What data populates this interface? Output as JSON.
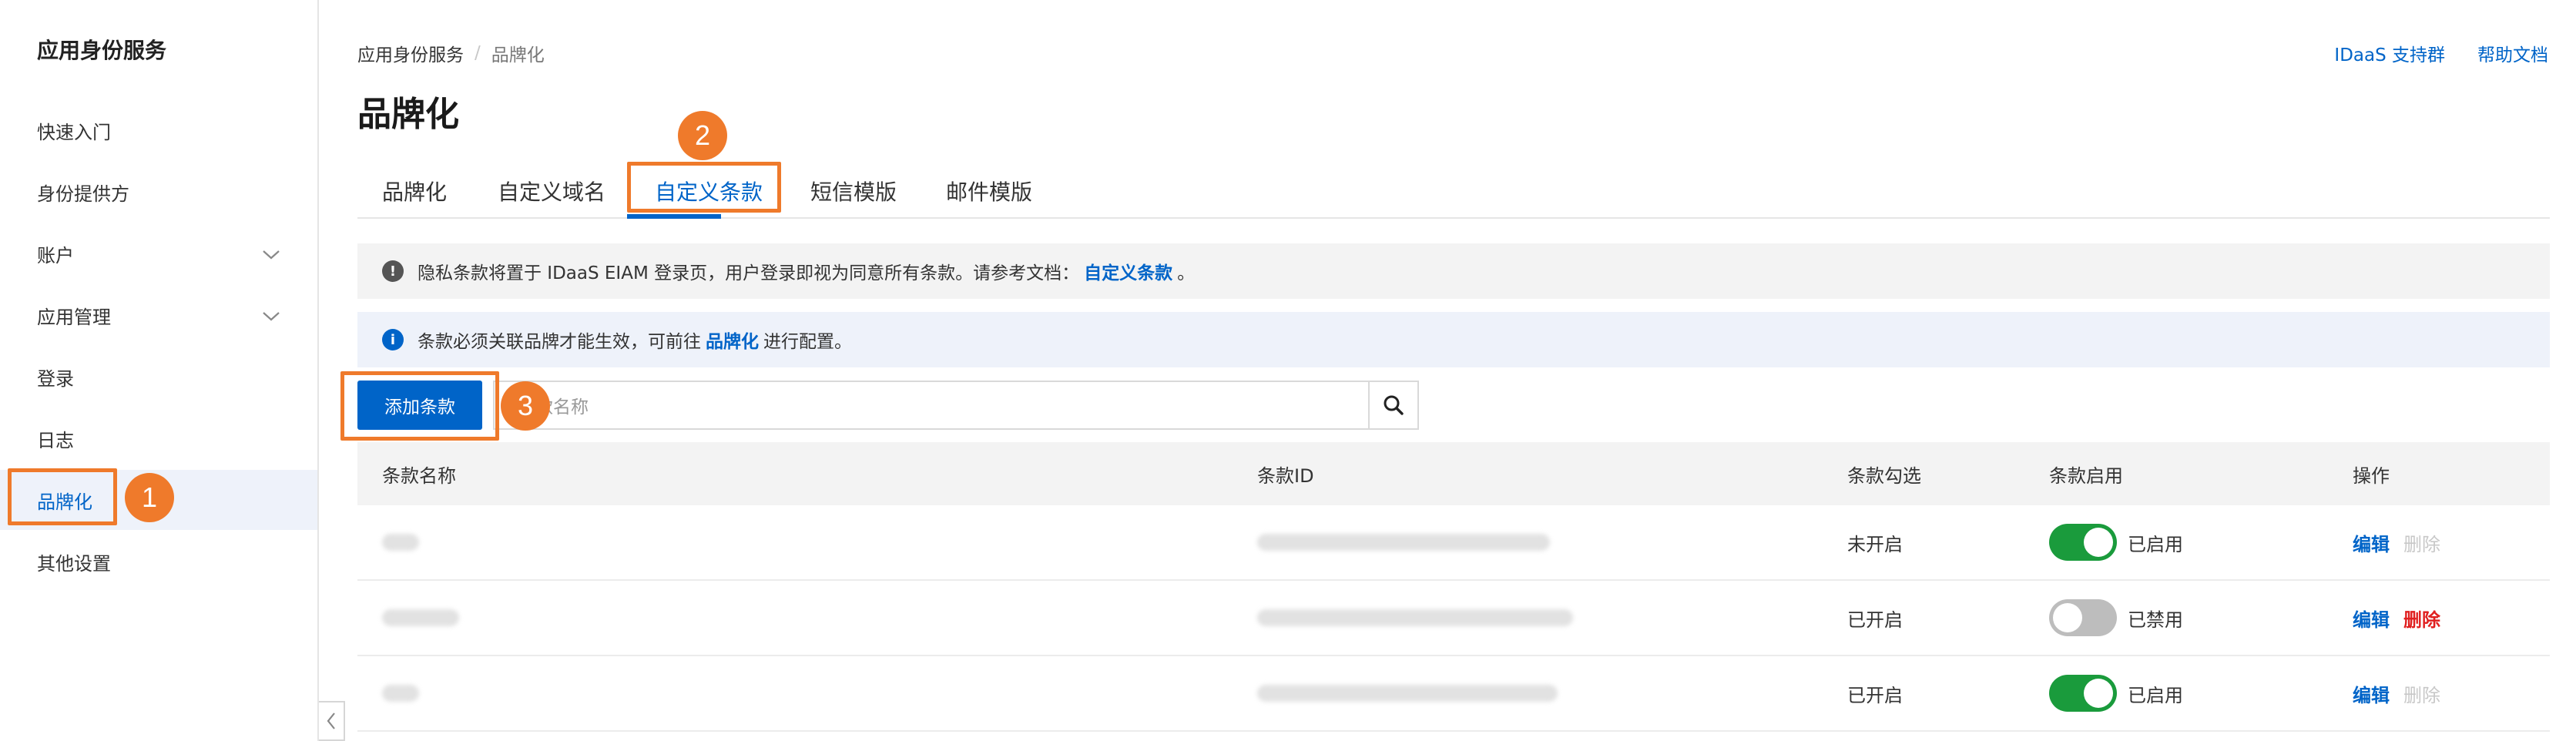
{
  "sidebar": {
    "app_title": "应用身份服务",
    "items": [
      {
        "label": "快速入门",
        "expandable": false,
        "active": false
      },
      {
        "label": "身份提供方",
        "expandable": false,
        "active": false
      },
      {
        "label": "账户",
        "expandable": true,
        "active": false
      },
      {
        "label": "应用管理",
        "expandable": true,
        "active": false
      },
      {
        "label": "登录",
        "expandable": false,
        "active": false
      },
      {
        "label": "日志",
        "expandable": false,
        "active": false
      },
      {
        "label": "品牌化",
        "expandable": false,
        "active": true
      },
      {
        "label": "其他设置",
        "expandable": false,
        "active": false
      }
    ]
  },
  "breadcrumb": {
    "root": "应用身份服务",
    "separator": "/",
    "current": "品牌化"
  },
  "top_links": {
    "support": "IDaaS 支持群",
    "help": "帮助文档"
  },
  "page_title": "品牌化",
  "tabs": [
    {
      "label": "品牌化",
      "active": false
    },
    {
      "label": "自定义域名",
      "active": false
    },
    {
      "label": "自定义条款",
      "active": true
    },
    {
      "label": "短信模版",
      "active": false
    },
    {
      "label": "邮件模版",
      "active": false
    }
  ],
  "notices": {
    "warning": {
      "icon": "exclamation-icon",
      "prefix": "隐私条款将置于 IDaaS EIAM 登录页，用户登录即视为同意所有条款。请参考文档：",
      "link": "自定义条款",
      "suffix": "。"
    },
    "info": {
      "icon": "info-icon",
      "prefix": "条款必须关联品牌才能生效，可前往",
      "link": "品牌化",
      "suffix": "进行配置。"
    }
  },
  "toolbar": {
    "add_button": "添加条款",
    "search_placeholder": "条款名称"
  },
  "table": {
    "headers": [
      "条款名称",
      "条款ID",
      "条款勾选",
      "条款启用",
      "操作"
    ],
    "rows": [
      {
        "check": "未开启",
        "enabled": true,
        "status": "已启用",
        "edit": "编辑",
        "delete": "删除",
        "delete_enabled": false
      },
      {
        "check": "已开启",
        "enabled": false,
        "status": "已禁用",
        "edit": "编辑",
        "delete": "删除",
        "delete_enabled": true
      },
      {
        "check": "已开启",
        "enabled": true,
        "status": "已启用",
        "edit": "编辑",
        "delete": "删除",
        "delete_enabled": false
      }
    ]
  },
  "annotations": [
    "1",
    "2",
    "3"
  ],
  "colors": {
    "accent": "#0064c8",
    "highlight": "#ef7a2b",
    "toggle_on": "#1a9b3c",
    "danger": "#e02020"
  }
}
